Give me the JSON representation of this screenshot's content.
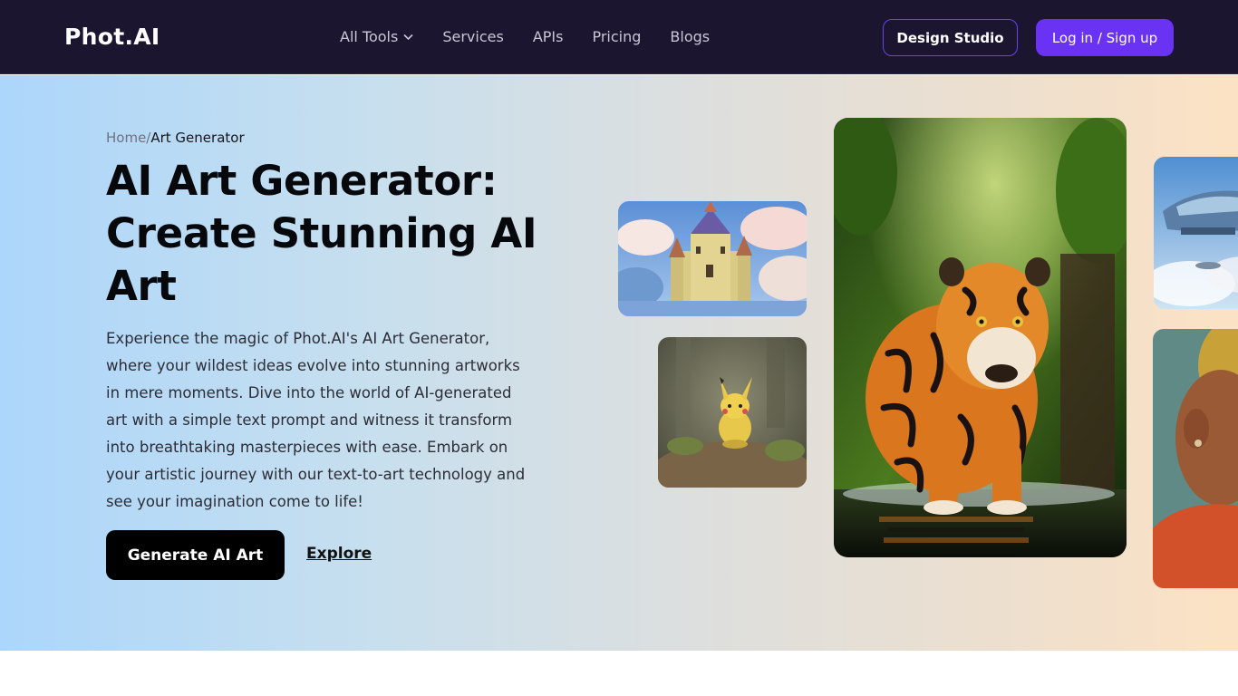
{
  "nav": {
    "logo": "Phot.AI",
    "links": [
      "All Tools",
      "Services",
      "APIs",
      "Pricing",
      "Blogs"
    ],
    "studio_label": "Design Studio",
    "login_label": "Log in / Sign up"
  },
  "hero": {
    "breadcrumb_home": "Home",
    "breadcrumb_sep": "/",
    "breadcrumb_current": "Art Generator",
    "title_line1": "AI Art Generator:",
    "title_line2": "Create Stunning AI",
    "title_line3": "Art",
    "description": "Experience the magic of Phot.AI's AI Art Generator, where your wildest ideas evolve into stunning artworks in mere moments. Dive into the world of AI-generated art with a simple text prompt and witness it transform into breathtaking masterpieces with ease. Embark on your artistic journey with our text-to-art technology and see your imagination come to life!",
    "cta_label": "Generate AI Art",
    "explore_label": "Explore"
  },
  "colors": {
    "nav_bg": "#1b1530",
    "accent": "#6a32f3",
    "cta_bg": "#000000"
  }
}
